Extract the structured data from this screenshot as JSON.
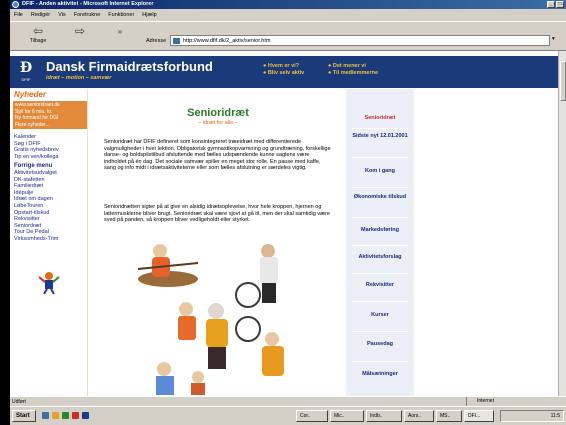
{
  "window": {
    "title": "DFIF - Anden aktivitet - Microsoft Internet Explorer"
  },
  "menu": [
    "Fiłe",
    "Redigér",
    "Vis",
    "Foretrukne",
    "Funktioner",
    "Hjælp"
  ],
  "toolbar": {
    "back": "Tilbage",
    "address_label": "Adresse",
    "url": "http://www.dfif.dk/2_aktiv/senior.htm",
    "go": "Gå til"
  },
  "header": {
    "brand": "Dansk Firmaidrætsforbund",
    "tagline": "idræt – motion – samvær",
    "logo_text": "DFIF",
    "links_col1": [
      "Hvem er vi?",
      "Bliv selv aktiv"
    ],
    "links_col2": [
      "Det mener vi",
      "Til medlemmerne"
    ]
  },
  "left": {
    "news_title": "Nyheder",
    "news_box": [
      "www.senioridraet.dk",
      "Spil for 6 mia. kr.",
      "Ny formand for DGI",
      "Flere nyheder..."
    ],
    "links1": [
      "Kalender",
      "Søg i DFIF",
      "Gratis nyhedsbrev",
      "Tip en ven/kollega"
    ],
    "menu_title": "Forrige menu",
    "links2": [
      "Aktivitetsudvalget",
      "DK-stafetten",
      "Familiedræt",
      "Idépulje",
      "Idræt om dagen",
      "LøbeTouren",
      "Opstart-tilskud",
      "Rekvisitter",
      "Seniordræt",
      "Tour De Pedal",
      "Virksomheds-Trim"
    ]
  },
  "main": {
    "title": "Senioridræt",
    "subtitle": "– idræt for alle –",
    "para1": "Senioridræt har DFIF defineret som konsintegreret træeidræt med differentierede valgmuligheder i hver lektion. Obligatorisk gymnastikopvarmning og grundtræning, forskellige danse- og boldspilstilbud afsluttende med fælles udspændende kunne sagtens være indholdet på én dag. Det sociale samvær spiller en meget stor rolle. En pause med kaffe, sang og info midt i idrætsaktiviteterne eller som fælles afslutning er særdeles vigtig.",
    "para2": "Senioridrætten sigter på at give en alsidig idrætsoplevelse, hvor hele kroppen, hjernen og lattermusklerne bliver brugt. Senioridræt skal være sjovt at gå til, men der skal samtidig være sved på panden, så kroppen bliver vedligeholdt eller styrket."
  },
  "rightnav": {
    "items": [
      "Senioridræt",
      "Sidste nyt 12.01.2001",
      "Kom i gang",
      "Økonomiske tilskud",
      "Markedsføring",
      "Aktivitetsforslag",
      "Rekvisitter",
      "Kurser",
      "Pausedag",
      "Målsætninger"
    ]
  },
  "status": {
    "left": "Udført",
    "zone": "Internet"
  },
  "taskbar": {
    "start": "Start",
    "tasks": [
      "Cor..",
      "Mic..",
      "Indb..",
      "Aors..",
      "MS..",
      "DFI..."
    ],
    "clock": "11:5"
  }
}
